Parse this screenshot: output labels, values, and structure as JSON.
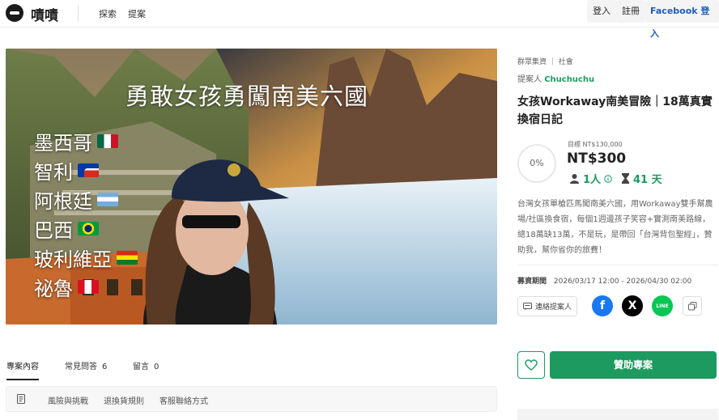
{
  "header": {
    "logo_text": "嘖嘖",
    "nav": [
      "探索",
      "提案"
    ],
    "login_label": "登入",
    "register_label": "註冊",
    "facebook_login_label": "Facebook 登入"
  },
  "hero": {
    "title": "勇敢女孩勇闖南美六國",
    "countries": [
      "墨西哥",
      "智利",
      "阿根廷",
      "巴西",
      "玻利維亞",
      "祕魯"
    ]
  },
  "project": {
    "category": "群眾集資 ｜ 社會",
    "proposer_label": "提案人",
    "proposer_name": "Chuchuchu",
    "title": "女孩Workaway南美冒險｜18萬真實換宿日記",
    "progress_percent": "0%",
    "goal_text": "目標 NT$130,000",
    "raised_amount": "NT$300",
    "backers": "1人",
    "days_left": "41 天",
    "description": "台灣女孩單槍匹馬闖南美六國，用Workaway雙手幫農場/社區換食宿，每個1週邊孩子笑容+實測南美路線，總18萬缺13萬，不是玩，是帶回「台灣背包聖經」，贊助我，幫你省你的旅費！",
    "period_label": "募資期間",
    "period_value": "2026/03/17 12:00 - 2026/04/30 02:00",
    "contact_label": "連絡提案人",
    "fund_button_label": "贊助專案"
  },
  "share": {
    "facebook_icon_text": "f",
    "x_icon_text": "X",
    "line_icon_text": "LINE",
    "colors": {
      "facebook": "#1877f2",
      "x": "#000000",
      "line": "#06c755"
    }
  },
  "tabs": [
    {
      "label": "專案內容",
      "count": ""
    },
    {
      "label": "常見問答",
      "count": "6"
    },
    {
      "label": "留言",
      "count": "0"
    }
  ],
  "subnav": [
    "風險與挑戰",
    "退換貨規則",
    "客服聯絡方式"
  ],
  "colors": {
    "accent": "#1d9a5f"
  }
}
